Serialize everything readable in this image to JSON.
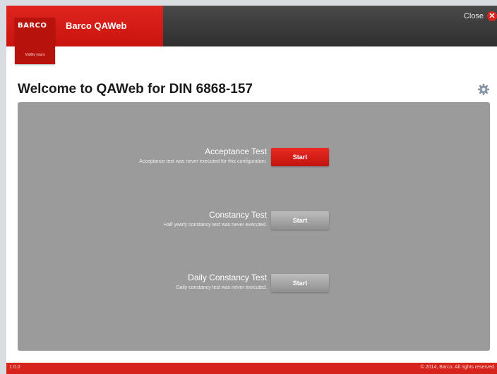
{
  "app": {
    "logo_text": "BARCO",
    "logo_tagline": "Visibly yours",
    "title": "Barco QAWeb",
    "close_label": "Close"
  },
  "page": {
    "title": "Welcome to QAWeb for DIN 6868-157"
  },
  "tests": [
    {
      "name": "Acceptance Test",
      "description": "Acceptance test was never executed for this configuration.",
      "button_label": "Start",
      "button_style": "primary"
    },
    {
      "name": "Constancy Test",
      "description": "Half yearly constancy test was never executed.",
      "button_label": "Start",
      "button_style": "secondary"
    },
    {
      "name": "Daily Constancy Test",
      "description": "Daily constancy test was never executed.",
      "button_label": "Start",
      "button_style": "secondary"
    }
  ],
  "footer": {
    "version": "1.0.0",
    "copyright": "© 2014, Barco. All rights reserved."
  },
  "colors": {
    "brand_red": "#d6231c",
    "panel_gray": "#9b9b9b",
    "topbar_dark": "#3a3a3a"
  },
  "icons": {
    "close": "close-icon",
    "settings": "gear-icon"
  }
}
